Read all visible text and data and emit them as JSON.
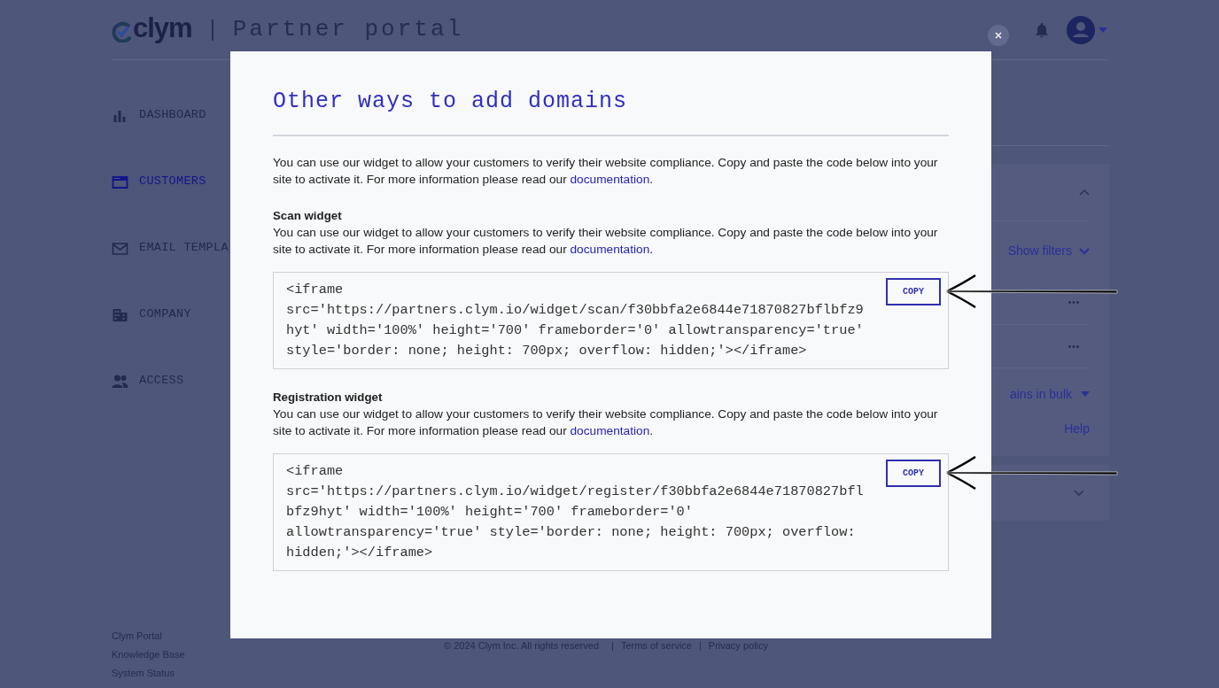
{
  "header": {
    "logo": "clym",
    "title": "Partner portal"
  },
  "nav": [
    {
      "label": "DASHBOARD",
      "selected": false
    },
    {
      "label": "CUSTOMERS",
      "selected": true
    },
    {
      "label": "EMAIL TEMPLA",
      "selected": false
    },
    {
      "label": "COMPANY",
      "selected": false
    },
    {
      "label": "ACCESS",
      "selected": false
    }
  ],
  "sidebar_links": [
    "Clym Portal",
    "Knowledge Base",
    "System Status"
  ],
  "background_panel": {
    "show_filters": "Show filters",
    "bulk_action": "ains in bulk",
    "help": "Help"
  },
  "footer": {
    "copyright": "© 2024 Clym Inc. All rights reserved",
    "separator": "|",
    "links": [
      "Terms of service",
      "Privacy policy"
    ]
  },
  "modal": {
    "title": "Other ways to add domains",
    "intro": {
      "text": "You can use our widget to allow your customers to verify their website compliance. Copy and paste the code below into your site to activate it. For more information please read our ",
      "link": "documentation",
      "end": "."
    },
    "sections": [
      {
        "heading": "Scan widget",
        "text": "You can use our widget to allow your customers to verify their website compliance. Copy and paste the code below into your site to activate it. For more information please read our ",
        "link": "documentation",
        "end": ".",
        "code": "<iframe src='https://partners.clym.io/widget/scan/f30bbfa2e6844e71870827bflbfz9hyt' width='100%' height='700' frameborder='0' allowtransparency='true' style='border: none; height: 700px; overflow: hidden;'></iframe>",
        "copy": "COPY"
      },
      {
        "heading": "Registration widget",
        "text": "You can use our widget to allow your customers to verify their website compliance. Copy and paste the code below into your site to activate it. For more information please read our ",
        "link": "documentation",
        "end": ".",
        "code": "<iframe src='https://partners.clym.io/widget/register/f30bbfa2e6844e71870827bflbfz9hyt' width='100%' height='700' frameborder='0' allowtransparency='true' style='border: none; height: 700px; overflow: hidden;'></iframe>",
        "copy": "COPY"
      }
    ]
  }
}
